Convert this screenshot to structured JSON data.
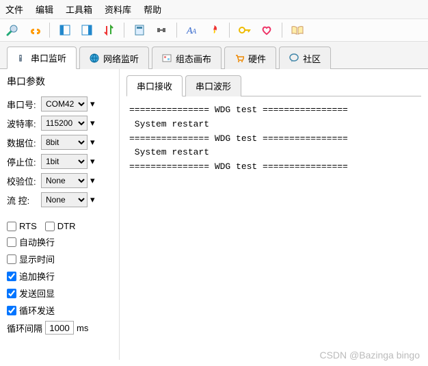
{
  "menu": [
    "文件",
    "编辑",
    "工具箱",
    "资料库",
    "帮助"
  ],
  "tabs": [
    {
      "label": "串口监听",
      "active": true
    },
    {
      "label": "网络监听",
      "active": false
    },
    {
      "label": "组态画布",
      "active": false
    },
    {
      "label": "硬件",
      "active": false
    },
    {
      "label": "社区",
      "active": false
    }
  ],
  "sidebar": {
    "title": "串口参数",
    "params": {
      "port_label": "串口号:",
      "port_value": "COM42",
      "baud_label": "波特率:",
      "baud_value": "115200",
      "databits_label": "数据位:",
      "databits_value": "8bit",
      "stopbits_label": "停止位:",
      "stopbits_value": "1bit",
      "parity_label": "校验位:",
      "parity_value": "None",
      "flow_label": "流   控:",
      "flow_value": "None"
    },
    "checks": {
      "rts": "RTS",
      "rts_checked": false,
      "dtr": "DTR",
      "dtr_checked": false,
      "autowrap": "自动换行",
      "autowrap_checked": false,
      "showtime": "显示时间",
      "showtime_checked": false,
      "appendlf": "追加换行",
      "appendlf_checked": true,
      "echo": "发送回显",
      "echo_checked": true,
      "loop": "循环发送",
      "loop_checked": true
    },
    "interval": {
      "label": "循环间隔",
      "value": "1000",
      "unit": "ms"
    }
  },
  "subtabs": [
    {
      "label": "串口接收",
      "active": true
    },
    {
      "label": "串口波形",
      "active": false
    }
  ],
  "output_lines": [
    "=============== WDG test ================",
    " System restart",
    "=============== WDG test ================",
    " System restart",
    "=============== WDG test ================"
  ],
  "watermark": "CSDN @Bazinga bingo"
}
